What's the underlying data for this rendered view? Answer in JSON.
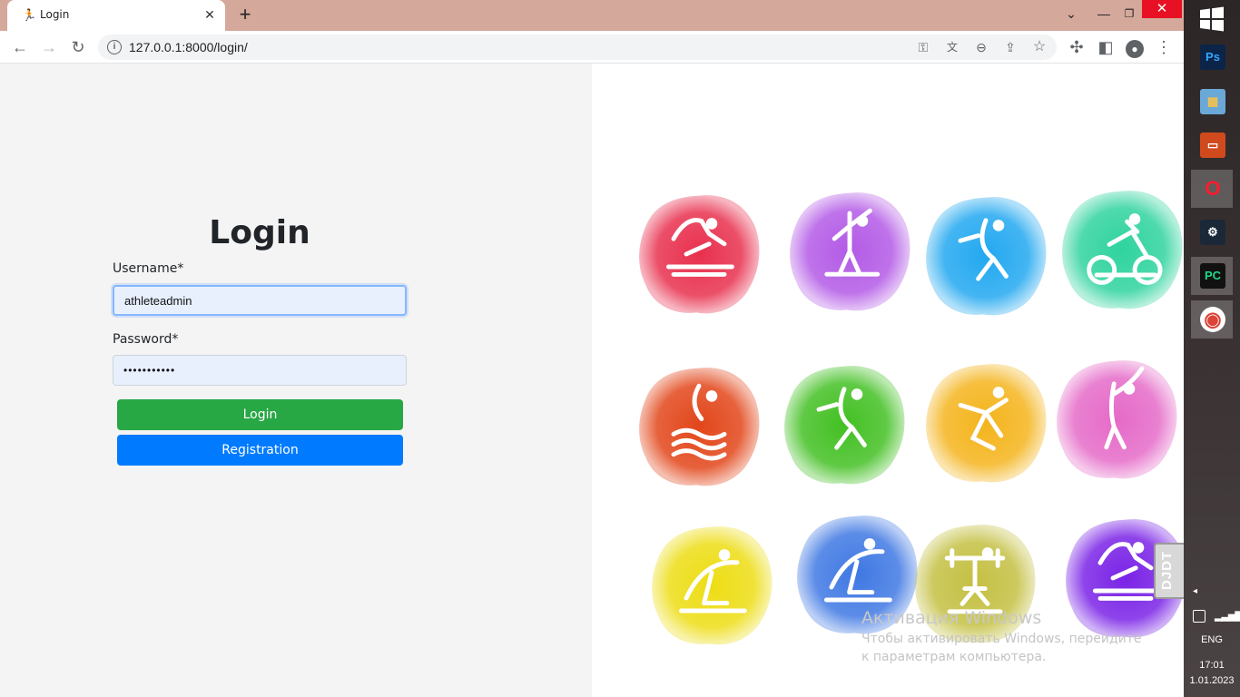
{
  "browser": {
    "tab_title": "Login",
    "url": "127.0.0.1:8000/login/"
  },
  "login_form": {
    "heading": "Login",
    "username_label": "Username*",
    "username_value": "athleteadmin",
    "password_label": "Password*",
    "password_value": "•••••••••••",
    "login_button": "Login",
    "registration_button": "Registration"
  },
  "sports_grid": {
    "colors": [
      "#e8304e",
      "#b35ae6",
      "#22a8f0",
      "#2fd39e",
      "#e2461a",
      "#43c023",
      "#f4b41c",
      "#e56ac8",
      "#eddd14",
      "#3f78e3",
      "#c4c043",
      "#7a23e6"
    ],
    "icons": [
      "running-icon",
      "tennis-icon",
      "volleyball-icon",
      "cycling-icon",
      "swimming-icon",
      "volleyball-icon",
      "handball-icon",
      "golf-icon",
      "gymnastics-icon",
      "gymnastics-icon",
      "weightlifting-icon",
      "running-icon"
    ]
  },
  "windows_activation": {
    "title": "Активация Windows",
    "text": "Чтобы активировать Windows, перейдите к параметрам компьютера."
  },
  "debug_toolbar": {
    "label": "DJDT"
  },
  "taskbar": {
    "apps": [
      "photoshop-icon",
      "photos-icon",
      "powerpoint-icon",
      "opera-icon",
      "steam-icon",
      "pycharm-icon",
      "chrome-icon"
    ],
    "language": "ENG",
    "time": "17:01",
    "date": "1.01.2023"
  }
}
